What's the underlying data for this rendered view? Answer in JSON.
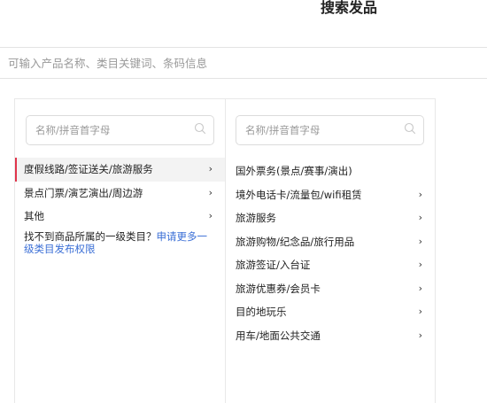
{
  "header": {
    "title": "搜索发品"
  },
  "search": {
    "placeholder": "可输入产品名称、类目关键词、条码信息"
  },
  "left_column": {
    "filter_placeholder": "名称/拼音首字母",
    "items": [
      {
        "label": "度假线路/签证送关/旅游服务",
        "chevron": "›",
        "active": true
      },
      {
        "label": "景点门票/演艺演出/周边游",
        "chevron": "›",
        "active": false
      },
      {
        "label": "其他",
        "chevron": "›",
        "active": false
      }
    ],
    "note_text": "找不到商品所属的一级类目？",
    "note_link": "申请更多一级类目发布权限"
  },
  "right_column": {
    "filter_placeholder": "名称/拼音首字母",
    "items": [
      {
        "label": "国外票务(景点/赛事/演出)",
        "chevron": ""
      },
      {
        "label": "境外电话卡/流量包/wifi租赁",
        "chevron": "›"
      },
      {
        "label": "旅游服务",
        "chevron": "›"
      },
      {
        "label": "旅游购物/纪念品/旅行用品",
        "chevron": "›"
      },
      {
        "label": "旅游签证/入台证",
        "chevron": "›"
      },
      {
        "label": "旅游优惠券/会员卡",
        "chevron": "›"
      },
      {
        "label": "目的地玩乐",
        "chevron": "›"
      },
      {
        "label": "用车/地面公共交通",
        "chevron": "›"
      }
    ]
  },
  "colors": {
    "active_accent": "#e0354b",
    "link": "#3b6fd6",
    "active_bg": "#f3f3f3"
  },
  "icons": {
    "filter_icon": "search-icon"
  }
}
